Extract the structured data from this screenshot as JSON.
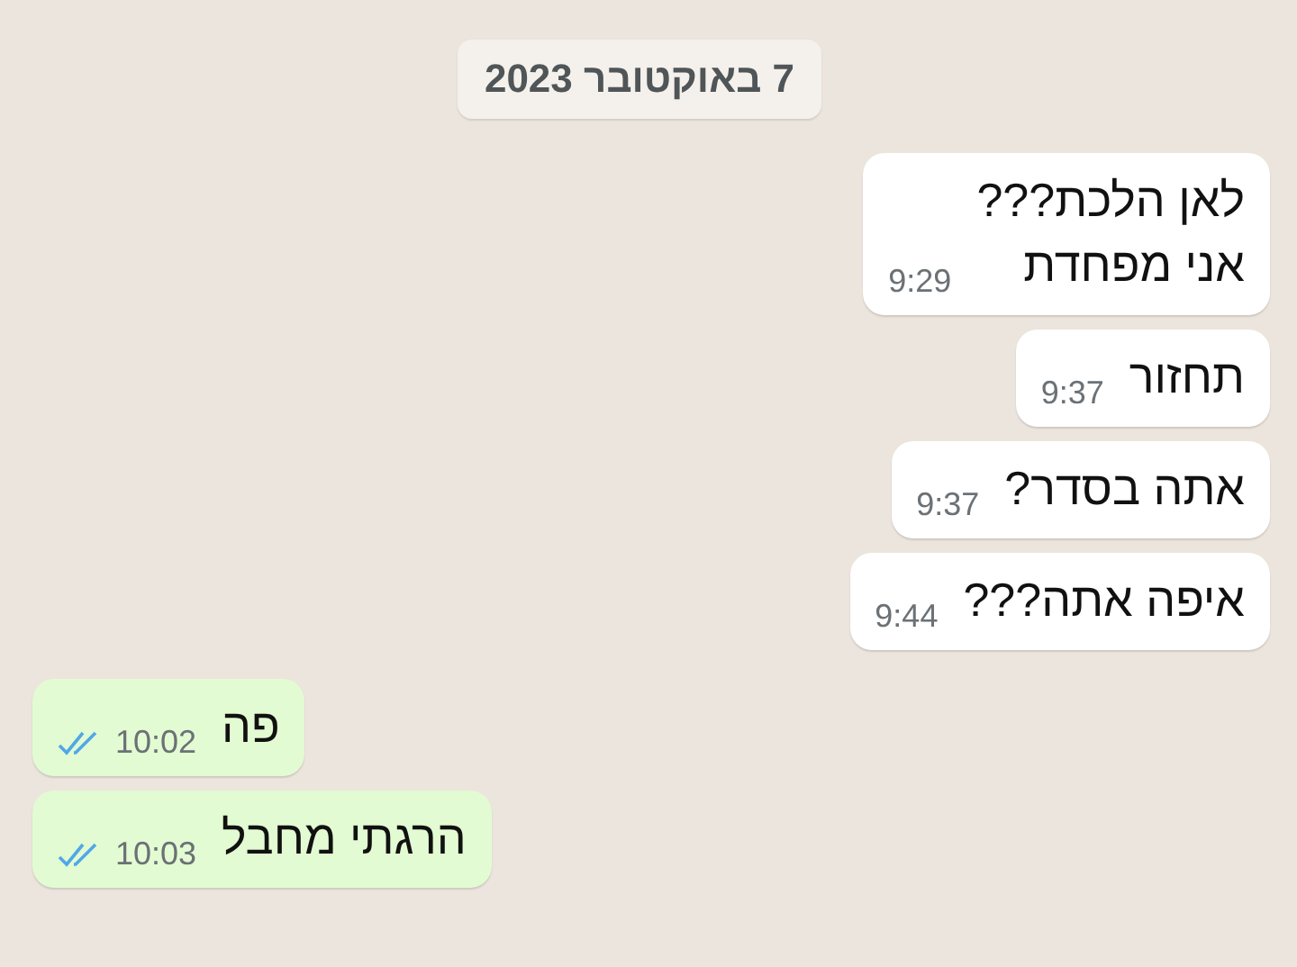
{
  "date_chip": "7 באוקטובר 2023",
  "messages": [
    {
      "kind": "incoming",
      "lines": [
        "לאן הלכת???",
        "אני מפחדת"
      ],
      "time": "9:29"
    },
    {
      "kind": "incoming",
      "lines": [
        "תחזור"
      ],
      "time": "9:37"
    },
    {
      "kind": "incoming",
      "lines": [
        "אתה בסדר?"
      ],
      "time": "9:37"
    },
    {
      "kind": "incoming",
      "lines": [
        "איפה אתה???"
      ],
      "time": "9:44"
    },
    {
      "kind": "outgoing",
      "lines": [
        "פה"
      ],
      "time": "10:02",
      "read": true
    },
    {
      "kind": "outgoing",
      "lines": [
        "הרגתי מחבל"
      ],
      "time": "10:03",
      "read": true
    }
  ]
}
